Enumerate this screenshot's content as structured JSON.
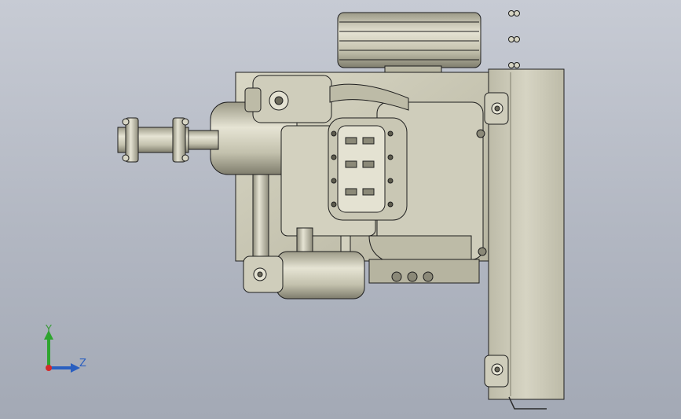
{
  "viewport": {
    "background_top": "#c7cbd4",
    "background_bottom": "#a3a9b5",
    "model_fill": "#c8c6b2",
    "model_dark": "#8f8d7c",
    "model_light": "#e4e2d2",
    "edge_color": "#1e1e1e"
  },
  "triad": {
    "y_label": "Y",
    "z_label": "Z",
    "y_color": "#2ea52e",
    "z_color": "#2a5fc0",
    "origin_color": "#d42a2a"
  }
}
